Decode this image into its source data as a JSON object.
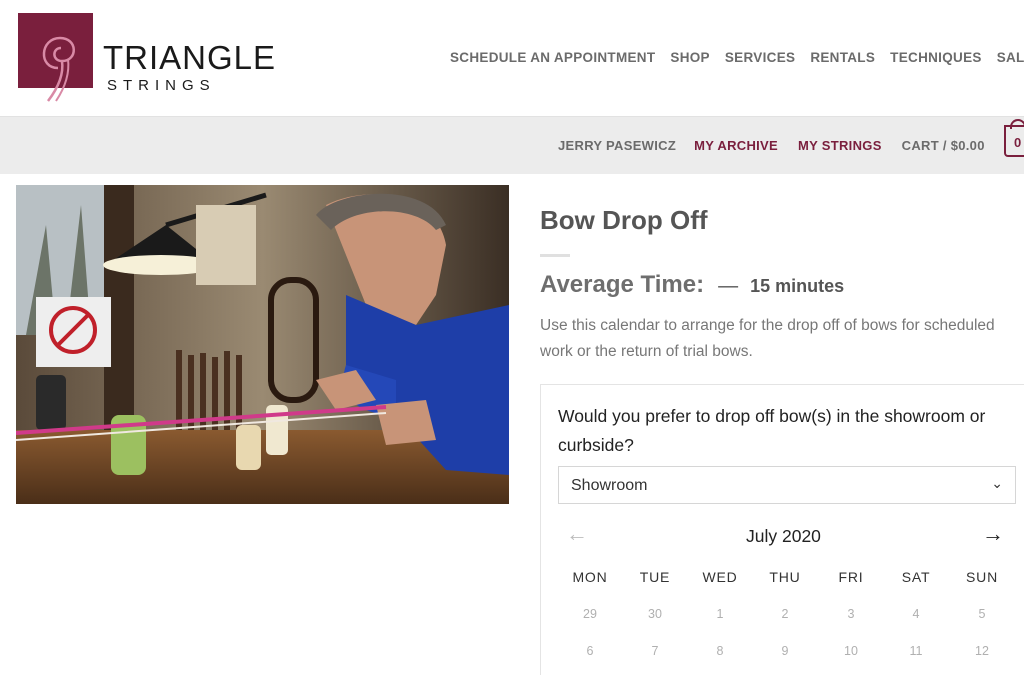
{
  "brand": {
    "title": "TRIANGLE",
    "subtitle": "STRINGS",
    "color": "#7a1f3d"
  },
  "main_nav": [
    "SCHEDULE AN APPOINTMENT",
    "SHOP",
    "SERVICES",
    "RENTALS",
    "TECHNIQUES",
    "SALES"
  ],
  "sub_nav": {
    "user": "JERRY PASEWICZ",
    "archive": "MY ARCHIVE",
    "strings": "MY STRINGS",
    "cart": "CART / $0.00",
    "cart_count": "0"
  },
  "product": {
    "title": "Bow Drop Off",
    "avg_label": "Average Time:",
    "avg_dash": "—",
    "avg_value": "15 minutes",
    "description": "Use this calendar to arrange for the drop off of bows for scheduled work or the return of trial bows."
  },
  "booking": {
    "question": "Would you prefer to drop off bow(s) in the showroom or curbside?",
    "select_value": "Showroom",
    "prev_icon": "arrow-left-icon",
    "next_icon": "arrow-right-icon",
    "month": "July 2020",
    "weekdays": [
      "MON",
      "TUE",
      "WED",
      "THU",
      "FRI",
      "SAT",
      "SUN"
    ],
    "week1": [
      "29",
      "30",
      "1",
      "2",
      "3",
      "4",
      "5"
    ],
    "week2": [
      "6",
      "7",
      "8",
      "9",
      "10",
      "11",
      "12"
    ]
  }
}
